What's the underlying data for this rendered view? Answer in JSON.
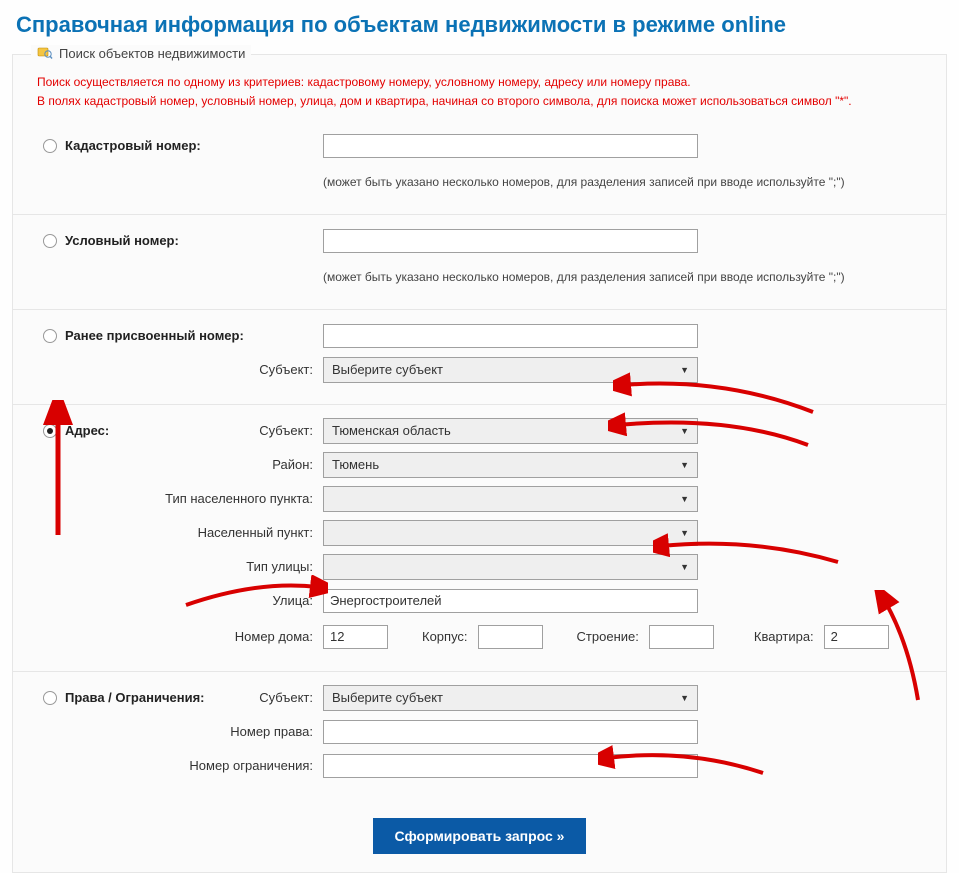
{
  "page_title": "Справочная информация по объектам недвижимости в режиме online",
  "legend": "Поиск объектов недвижимости",
  "hint1": "Поиск осуществляется по одному из критериев: кадастровому номеру, условному номеру, адресу или номеру права.",
  "hint2": "В полях кадастровый номер, условный номер, улица, дом и квартира, начиная со второго символа, для поиска может использоваться символ \"*\".",
  "cadastral": {
    "label": "Кадастровый номер:",
    "value": "",
    "sublabel": "(может быть указано несколько номеров, для разделения записей при вводе используйте \";\")"
  },
  "conditional": {
    "label": "Условный номер:",
    "value": "",
    "sublabel": "(может быть указано несколько номеров, для разделения записей при вводе используйте \";\")"
  },
  "previous": {
    "label": "Ранее присвоенный номер:",
    "value": "",
    "subject_label": "Субъект:",
    "subject_value": "Выберите субъект"
  },
  "address": {
    "label": "Адрес:",
    "subject_label": "Субъект:",
    "subject_value": "Тюменская область",
    "district_label": "Район:",
    "district_value": "Тюмень",
    "settlement_type_label": "Тип населенного пункта:",
    "settlement_type_value": "",
    "settlement_label": "Населенный пункт:",
    "settlement_value": "",
    "street_type_label": "Тип улицы:",
    "street_type_value": "",
    "street_label": "Улица:",
    "street_value": "Энергостроителей",
    "house_label": "Номер дома:",
    "house_value": "12",
    "corpus_label": "Корпус:",
    "corpus_value": "",
    "building_label": "Строение:",
    "building_value": "",
    "apartment_label": "Квартира:",
    "apartment_value": "2"
  },
  "rights": {
    "label": "Права / Ограничения:",
    "subject_label": "Субъект:",
    "subject_value": "Выберите субъект",
    "right_number_label": "Номер права:",
    "right_number_value": "",
    "limit_number_label": "Номер ограничения:",
    "limit_number_value": ""
  },
  "submit_label": "Сформировать запрос »"
}
